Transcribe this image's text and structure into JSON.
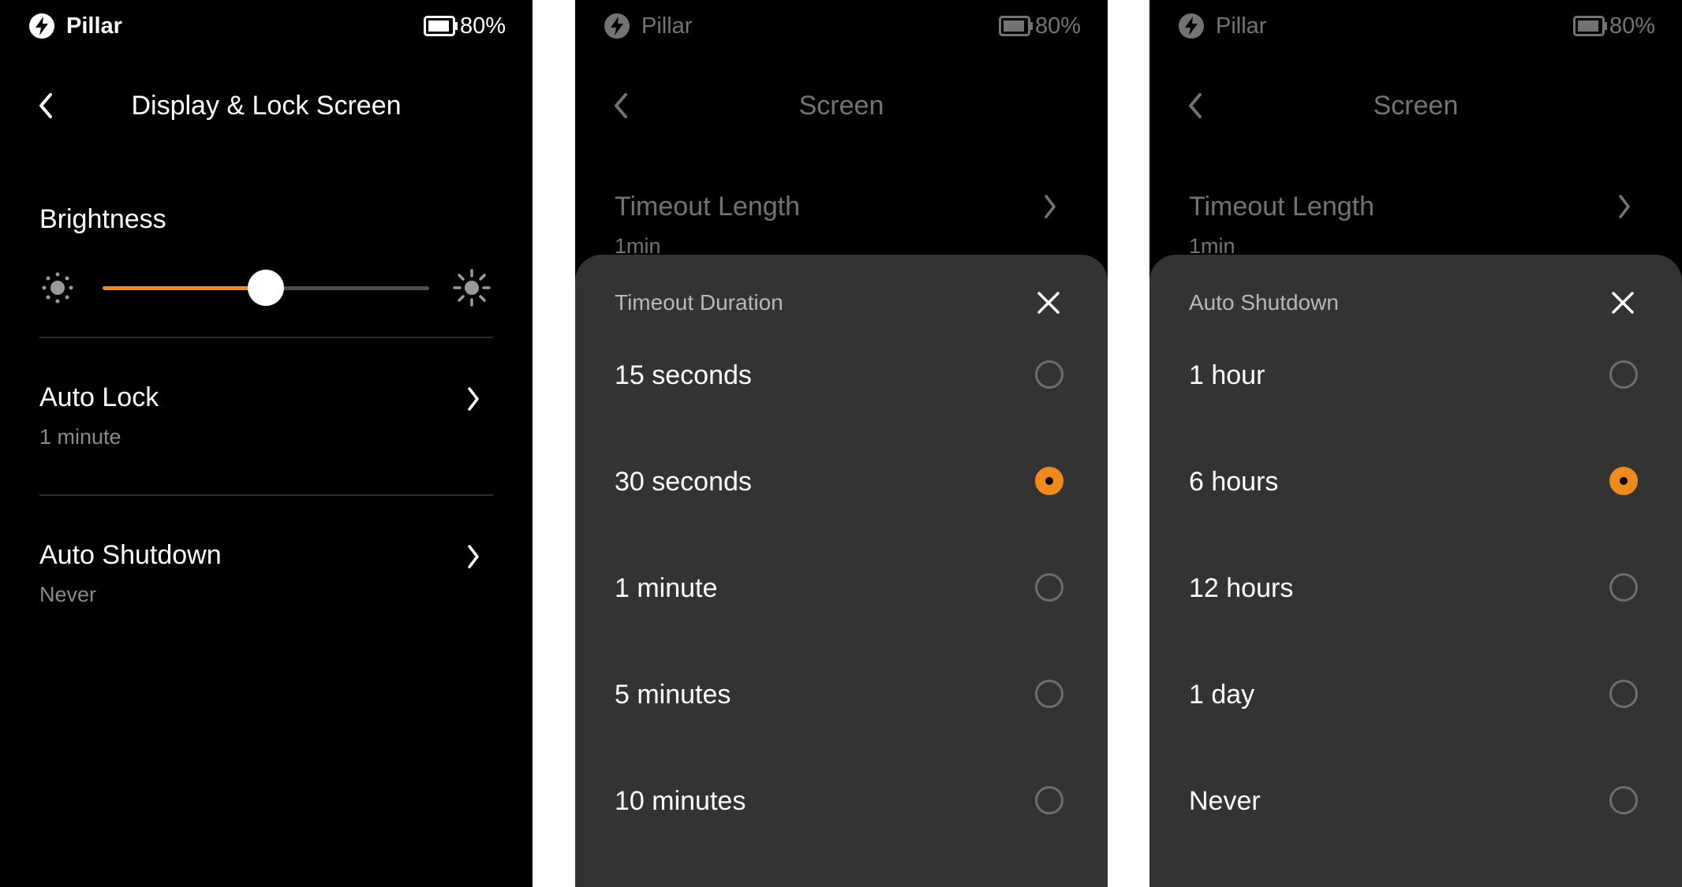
{
  "status_bar": {
    "brand": "Pillar",
    "battery": "80%",
    "logo_icon": "bolt-icon",
    "battery_icon": "battery-icon"
  },
  "colors": {
    "accent": "#f08a1c",
    "sheet_bg": "#333333",
    "screen_bg": "#000000"
  },
  "screen1": {
    "title": "Display & Lock Screen",
    "brightness": {
      "label": "Brightness",
      "level_fraction": 0.5
    },
    "auto_lock": {
      "label": "Auto Lock",
      "value": "1 minute"
    },
    "auto_shutdown": {
      "label": "Auto Shutdown",
      "value": "Never"
    }
  },
  "screen2": {
    "title": "Screen",
    "row": {
      "label": "Timeout Length",
      "value": "1min"
    },
    "sheet": {
      "title": "Timeout Duration",
      "options": [
        "15 seconds",
        "30 seconds",
        "1 minute",
        "5 minutes",
        "10 minutes"
      ],
      "selected_index": 1
    }
  },
  "screen3": {
    "title": "Screen",
    "row": {
      "label": "Timeout Length",
      "value": "1min"
    },
    "sheet": {
      "title": "Auto Shutdown",
      "options": [
        "1 hour",
        "6 hours",
        "12 hours",
        "1 day",
        "Never"
      ],
      "selected_index": 1
    }
  }
}
